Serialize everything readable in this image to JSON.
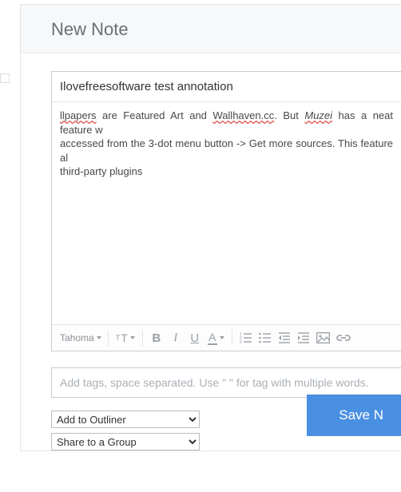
{
  "header": {
    "title": "New Note"
  },
  "note": {
    "title": "Ilovefreesoftware test annotation",
    "body_parts": {
      "p1": "llpapers",
      "p2": " are Featured Art and ",
      "p3": "Wallhaven.cc",
      "p4": ". But ",
      "p5": "Muzei",
      "p6": " has a neat feature w",
      "p7": "accessed from the 3-dot menu button -> Get more sources. This feature al",
      "p8": "third-party plugins"
    }
  },
  "toolbar": {
    "font": "Tahoma"
  },
  "tags": {
    "placeholder": "Add tags, space separated. Use \" \" for tag with multiple words."
  },
  "selects": {
    "outliner": "Add to Outliner",
    "share": "Share to a Group"
  },
  "actions": {
    "save": "Save N"
  }
}
